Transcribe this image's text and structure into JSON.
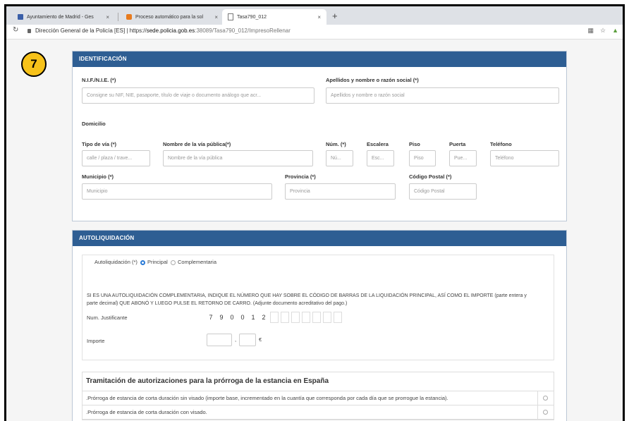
{
  "browser": {
    "tabs": [
      {
        "title": "Ayuntamiento de Madrid - Ges",
        "close": "×"
      },
      {
        "title": "Proceso automático para la sol",
        "close": "×"
      },
      {
        "title": "Tasa790_012",
        "close": "×"
      }
    ],
    "new_tab": "+",
    "site_name": "Dirección General de la Policía [ES]",
    "url_separator": "|",
    "url_scheme": "https://",
    "url_domain": "sede.policia.gob.es",
    "url_path": ":38089/Tasa790_012/ImpresoRellenar"
  },
  "step_badge": "7",
  "identificacion": {
    "header": "IDENTIFICACIÓN",
    "nif_label": "N.I.F./N.I.E. (*)",
    "nif_placeholder": "Consigne su NIF, NIE, pasaporte, título de viaje o documento análogo que acr...",
    "nombre_label": "Apellidos y nombre o razón social (*)",
    "nombre_placeholder": "Apellidos y nombre o razón social",
    "domicilio_label": "Domicilio",
    "tipo_via_label": "Tipo de vía (*)",
    "tipo_via_placeholder": "calle / plaza / trave...",
    "via_label": "Nombre de la vía pública(*)",
    "via_placeholder": "Nombre de la vía pública",
    "num_label": "Núm. (*)",
    "num_placeholder": "Nú...",
    "escalera_label": "Escalera",
    "escalera_placeholder": "Esc...",
    "piso_label": "Piso",
    "piso_placeholder": "Piso",
    "puerta_label": "Puerta",
    "puerta_placeholder": "Pue...",
    "telefono_label": "Teléfono",
    "telefono_placeholder": "Teléfono",
    "municipio_label": "Municipio (*)",
    "municipio_placeholder": "Municipio",
    "provincia_label": "Provincia (*)",
    "provincia_placeholder": "Provincia",
    "cp_label": "Código Postal (*)",
    "cp_placeholder": "Código Postal"
  },
  "autoliquidacion": {
    "header": "AUTOLIQUIDACIÓN",
    "type_label": "Autoliquidación (*)",
    "option_principal": "Principal",
    "option_complementaria": "Complementaria",
    "selected": "Principal",
    "instructions": "SI ES UNA AUTOLIQUIDACIÓN COMPLEMENTARIA, INDIQUE EL NÚMERO QUE HAY SOBRE EL CÓDIGO DE BARRAS DE LA LIQUIDACIÓN PRINCIPAL, ASÍ COMO EL IMPORTE (parte entera y parte decimal) QUE ABONÓ Y LUEGO PULSE EL RETORNO DE CARRO. (Adjunte documento acreditativo del pago.)",
    "justificante_label": "Num. Justificante",
    "justificante_digits": [
      "7",
      "9",
      "0",
      "0",
      "1",
      "2",
      "",
      "",
      "",
      "",
      "",
      "",
      ""
    ],
    "importe_label": "Importe",
    "importe_separator": ",",
    "currency": "€"
  },
  "tramitacion": {
    "title": "Tramitación de autorizaciones para la prórroga de la estancia en España",
    "rows": [
      {
        "text": ".Prórroga de estancia de corta duración sin visado (importe base, incrementado en la cuantía que corresponda por cada día que se prorrogue la estancia)."
      },
      {
        "text": ".Prórroga de estancia de corta duración con visado."
      }
    ]
  },
  "colors": {
    "panel_header": "#2e5e93",
    "badge": "#f7c21a",
    "radio_selected": "#2a7ad6"
  }
}
